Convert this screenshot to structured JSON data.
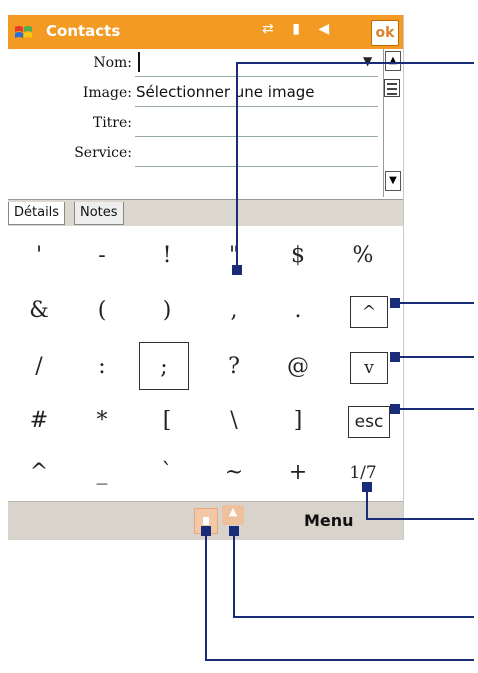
{
  "titlebar": {
    "app_title": "Contacts",
    "ok_label": "ok",
    "status_icons": [
      "connectivity-icon",
      "signal-icon",
      "volume-icon"
    ],
    "accent_color": "#f39a22"
  },
  "form": {
    "fields": [
      {
        "label": "Nom:",
        "value": ""
      },
      {
        "label": "Image:",
        "value": "Sélectionner une image"
      },
      {
        "label": "Titre:",
        "value": ""
      },
      {
        "label": "Service:",
        "value": ""
      }
    ]
  },
  "tabs": [
    {
      "label": "Détails",
      "active": true
    },
    {
      "label": "Notes",
      "active": false
    }
  ],
  "keyboard": {
    "rows": [
      [
        "'",
        "-",
        "!",
        "\"",
        "$",
        "%"
      ],
      [
        "&",
        "(",
        ")",
        ",",
        ".",
        "^"
      ],
      [
        "/",
        ":",
        ";",
        "?",
        "@",
        "v"
      ],
      [
        "#",
        "*",
        "[",
        "\\",
        "]",
        "esc"
      ],
      [
        "^",
        "_",
        "`",
        "~",
        "+",
        "1/7"
      ]
    ],
    "page_indicator": "1/7",
    "esc_label": "esc"
  },
  "bottombar": {
    "menu_label": "Menu"
  },
  "colors": {
    "callout": "#1a2b7a",
    "title_bar": "#f39a22",
    "menu_bar": "#d8d4cc"
  }
}
